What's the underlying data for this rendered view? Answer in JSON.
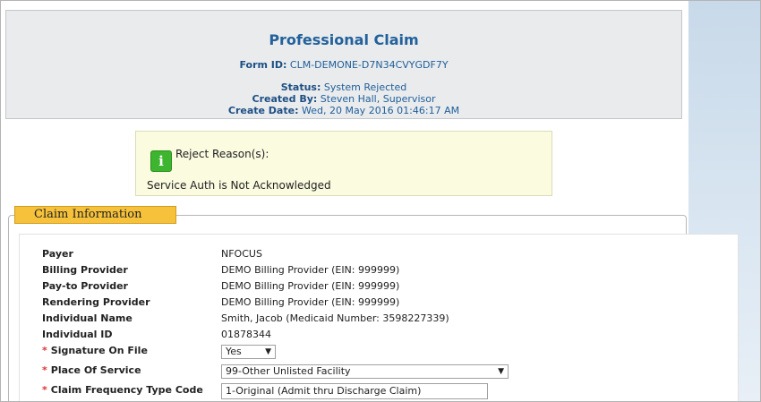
{
  "header": {
    "title": "Professional Claim",
    "form_id_label": "Form ID:",
    "form_id": "CLM-DEMONE-D7N34CVYGDF7Y",
    "status_label": "Status:",
    "status": "System Rejected",
    "created_by_label": "Created By:",
    "created_by": "Steven Hall, Supervisor",
    "create_date_label": "Create Date:",
    "create_date": "Wed, 20 May 2016 01:46:17 AM"
  },
  "reject": {
    "icon": "info-icon",
    "icon_glyph": "i",
    "title": "Reject Reason(s):",
    "message": "Service Auth is Not Acknowledged"
  },
  "section": {
    "title": "Claim Information"
  },
  "fields": {
    "payer": {
      "label": "Payer",
      "value": "NFOCUS"
    },
    "billing_provider": {
      "label": "Billing Provider",
      "value": "DEMO Billing Provider (EIN: 999999)"
    },
    "pay_to_provider": {
      "label": "Pay-to Provider",
      "value": "DEMO Billing Provider (EIN: 999999)"
    },
    "rendering_provider": {
      "label": "Rendering Provider",
      "value": "DEMO Billing Provider (EIN: 999999)"
    },
    "individual_name": {
      "label": "Individual Name",
      "value": "Smith, Jacob (Medicaid Number: 3598227339)"
    },
    "individual_id": {
      "label": "Individual ID",
      "value": "01878344"
    },
    "signature_on_file": {
      "label": "Signature On File",
      "value": "Yes",
      "required_mark": "*"
    },
    "place_of_service": {
      "label": "Place Of Service",
      "value": "99-Other Unlisted Facility",
      "required_mark": "*"
    },
    "claim_frequency": {
      "label": "Claim Frequency Type Code",
      "value": "1-Original (Admit thru Discharge Claim)",
      "required_mark": "*"
    }
  },
  "colors": {
    "title": "#22619b",
    "section_tab": "#f6c23c",
    "reject_bg": "#fbfbe0",
    "icon_green": "#3db52e",
    "required": "#dd3333"
  }
}
